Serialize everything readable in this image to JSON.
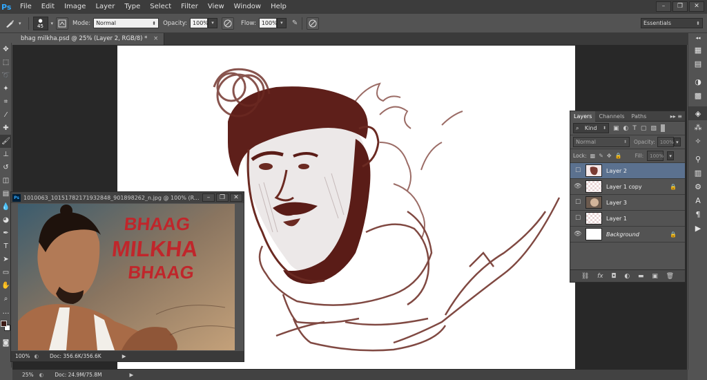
{
  "app": {
    "logo": "Ps",
    "menu": [
      "File",
      "Edit",
      "Image",
      "Layer",
      "Type",
      "Select",
      "Filter",
      "View",
      "Window",
      "Help"
    ],
    "window_controls": [
      "–",
      "❐",
      "✕"
    ]
  },
  "options_bar": {
    "brush_size": "45",
    "mode_label": "Mode:",
    "mode_value": "Normal",
    "opacity_label": "Opacity:",
    "opacity_value": "100%",
    "flow_label": "Flow:",
    "flow_value": "100%",
    "workspace": "Essentials"
  },
  "document": {
    "tab_title": "bhag milkha.psd @ 25% (Layer 2, RGB/8) *",
    "zoom": "25%",
    "doc_size": "Doc: 24.9M/75.8M"
  },
  "reference_window": {
    "title": "1010063_10151782171932848_901898262_n.jpg @ 100% (R...",
    "zoom": "100%",
    "doc_size": "Doc: 356.6K/356.6K",
    "poster_text": [
      "BHAAG",
      "MILKHA",
      "BHAAG"
    ]
  },
  "layers_panel": {
    "tabs": [
      "Layers",
      "Channels",
      "Paths"
    ],
    "filter_kind": "Kind",
    "blend_mode": "Normal",
    "opacity_label": "Opacity:",
    "opacity_value": "100%",
    "lock_label": "Lock:",
    "fill_label": "Fill:",
    "fill_value": "100%",
    "layers": [
      {
        "name": "Layer 2",
        "visible": false,
        "selected": true,
        "locked": false,
        "italic": false
      },
      {
        "name": "Layer 1 copy",
        "visible": true,
        "selected": false,
        "locked": true,
        "italic": false
      },
      {
        "name": "Layer 3",
        "visible": false,
        "selected": false,
        "locked": false,
        "italic": false
      },
      {
        "name": "Layer 1",
        "visible": false,
        "selected": false,
        "locked": false,
        "italic": false
      },
      {
        "name": "Background",
        "visible": true,
        "selected": false,
        "locked": true,
        "italic": true
      }
    ]
  },
  "colors": {
    "sketch_stroke": "#6b2a22",
    "selected_layer": "#5b718f",
    "poster_red": "#c0262b",
    "foreground_color": "#3b1a14",
    "background_color": "#ffffff"
  }
}
